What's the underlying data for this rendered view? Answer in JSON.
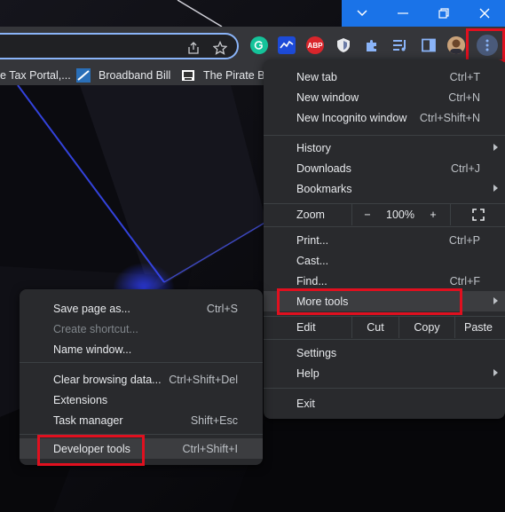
{
  "toolbar": {
    "extensions": [
      "grammarly-icon",
      "stocks-icon",
      "adblock-plus-icon",
      "shield-icon",
      "puzzle-icon",
      "media-icon",
      "sidepanel-icon",
      "avatar"
    ],
    "adblock_text": "ABP"
  },
  "bookmarks": [
    {
      "label": "e Tax Portal,..."
    },
    {
      "label": "Broadband Bill"
    },
    {
      "label": "The Pirate Ba"
    }
  ],
  "main_menu": {
    "new_tab": {
      "label": "New tab",
      "shortcut": "Ctrl+T"
    },
    "new_window": {
      "label": "New window",
      "shortcut": "Ctrl+N"
    },
    "incognito": {
      "label": "New Incognito window",
      "shortcut": "Ctrl+Shift+N"
    },
    "history": {
      "label": "History"
    },
    "downloads": {
      "label": "Downloads",
      "shortcut": "Ctrl+J"
    },
    "bookmarks": {
      "label": "Bookmarks"
    },
    "zoom": {
      "label": "Zoom",
      "minus": "−",
      "value": "100%",
      "plus": "+"
    },
    "print": {
      "label": "Print...",
      "shortcut": "Ctrl+P"
    },
    "cast": {
      "label": "Cast..."
    },
    "find": {
      "label": "Find...",
      "shortcut": "Ctrl+F"
    },
    "more_tools": {
      "label": "More tools"
    },
    "edit": {
      "label": "Edit",
      "cut": "Cut",
      "copy": "Copy",
      "paste": "Paste"
    },
    "settings": {
      "label": "Settings"
    },
    "help": {
      "label": "Help"
    },
    "exit": {
      "label": "Exit"
    }
  },
  "sub_menu": {
    "save_page": {
      "label": "Save page as...",
      "shortcut": "Ctrl+S"
    },
    "create_shortcut": {
      "label": "Create shortcut..."
    },
    "name_window": {
      "label": "Name window..."
    },
    "clear_data": {
      "label": "Clear browsing data...",
      "shortcut": "Ctrl+Shift+Del"
    },
    "extensions": {
      "label": "Extensions"
    },
    "task_manager": {
      "label": "Task manager",
      "shortcut": "Shift+Esc"
    },
    "dev_tools": {
      "label": "Developer tools",
      "shortcut": "Ctrl+Shift+I"
    }
  },
  "colors": {
    "accent": "#1a73e8",
    "highlight_box": "#e0101f",
    "menu_bg": "#292a2d",
    "toolbar_bg": "#35363a"
  }
}
